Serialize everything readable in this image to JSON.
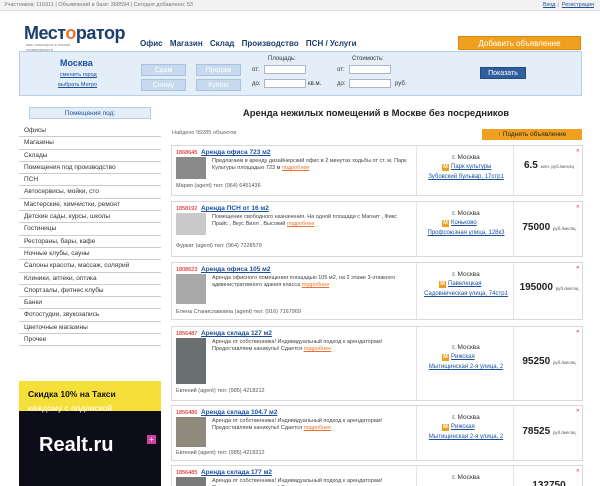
{
  "topbar": {
    "stats": "Участников: 116911 | Объявлений в базе: 368594 | Сегодня добавлено: 53",
    "login": "Вход",
    "register": "Регистрация"
  },
  "logo": {
    "part1": "Мест",
    "part2": "о",
    "part3": "ратор",
    "tagline": "ваш помощник в поиске недвижимости"
  },
  "nav": [
    "Офис",
    "Магазин",
    "Склад",
    "Производство",
    "ПСН / Услуги"
  ],
  "add_button": "Добавить объявление",
  "search": {
    "city": "Москва",
    "change_city": "сменить город",
    "choose_metro": "выбрать Метро",
    "rent_out": "Сдам",
    "sell": "Продам",
    "rent": "Сниму",
    "buy": "Куплю",
    "area_label": "Площадь:",
    "cost_label": "Стоимость:",
    "from": "от:",
    "to": "до:",
    "area_unit": "кв.м.",
    "cost_unit": "руб.",
    "show": "Показать"
  },
  "sidebar": {
    "header": "Помещения под:",
    "items": [
      "Офисы",
      "Магазины",
      "Склады",
      "Помещения под производство",
      "ПСН",
      "Автосервисы, мойки, сто",
      "Мастерские, химчистки, ремонт",
      "Детские сады, курсы, школы",
      "Гостиницы",
      "Рестораны, бары, кафе",
      "Ночные клубы, сауны",
      "Салоны красоты, массаж, солярий",
      "Клиники, аптеки, оптика",
      "Спортзалы, фитнес клубы",
      "Банки",
      "Фотостудии, звукозапись",
      "Цветочные магазины",
      "Прочее"
    ]
  },
  "banner": {
    "line1": "Скидка 10% на Такси",
    "line2": "каждому с подпиской",
    "line3": "Realt.ru",
    "plus": "+"
  },
  "main": {
    "title": "Аренда нежилых помещений в Москве без посредников",
    "found": "Найдено 99285 объектов",
    "up_button": "↑ Поднять объявление",
    "more": "подробнее"
  },
  "listings": [
    {
      "id": "1868645",
      "title": "Аренда офиса 723 м2",
      "desc": "Предлагаем в аренду дизайнерский офис в 2 минутах ходьбы от ст. м. Парк Культуры площадью 723 м",
      "contact": "Мария (agent)   тел: (964) 6451436",
      "city": "г. Москва",
      "metro": "Парк культуры",
      "street": "Зубовский бульвар, 17стр1",
      "price": "6.5",
      "unit": "млн. руб./месяц"
    },
    {
      "id": "1858192",
      "title": "Аренда ПСН от 16 м2",
      "desc": "Помещение свободного назначения. На одной площади с Магнит , Фикс Прайс , Вкус Вилл , Высокий",
      "contact": "Фуркат (agent)   тел: (964) 7228579",
      "city": "г. Москва",
      "metro": "Коньково",
      "street": "Профсоюзная улица, 128к3",
      "price": "75000",
      "unit": "руб./месяц"
    },
    {
      "id": "1808623",
      "title": "Аренда офиса 105 м2",
      "desc": "Аренда офисного помещения площадью 105 м2, на 2 этаже 3-этажного административного здания класса",
      "contact": "Елена Станиславовна (agent)   тел: (916) 7167969",
      "city": "г. Москва",
      "metro": "Павелецкая",
      "street": "Садовническая улица, 74стр1",
      "price": "195000",
      "unit": "руб./месяц"
    },
    {
      "id": "1856487",
      "title": "Аренда склада 127 м2",
      "desc": "Аренда от собственника! Индивидуальный подход к арендаторам! Предоставляем каникулы! Сдается",
      "contact": "Евгений (agent)   тел: (985) 4218212",
      "city": "г. Москва",
      "metro": "Рижская",
      "street": "Мытищинская 2-я улица, 2",
      "price": "95250",
      "unit": "руб./месяц"
    },
    {
      "id": "1856486",
      "title": "Аренда склада 104.7 м2",
      "desc": "Аренда от собственника! Индивидуальный подход к арендаторам! Предоставляем каникулы! Сдается",
      "contact": "Евгений (agent)   тел: (985) 4218212",
      "city": "г. Москва",
      "metro": "Рижская",
      "street": "Мытищинская 2-я улица, 2",
      "price": "78525",
      "unit": "руб./месяц"
    },
    {
      "id": "1856485",
      "title": "Аренда склада 177 м2",
      "desc": "Аренда от собственника! Индивидуальный подход к арендаторам! Предоставляем каникулы! Сдается",
      "contact": "",
      "city": "г. Москва",
      "metro": "",
      "street": "",
      "price": "132750",
      "unit": ""
    }
  ]
}
